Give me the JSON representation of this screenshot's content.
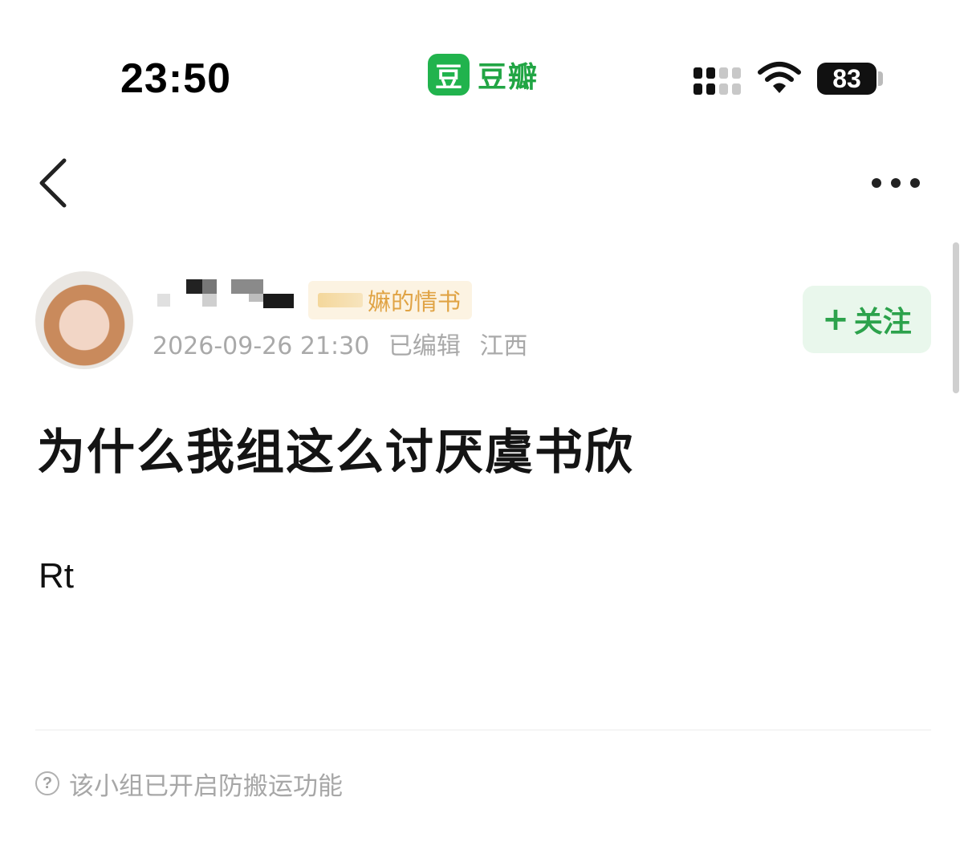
{
  "status_bar": {
    "time": "23:50",
    "app_logo_char": "豆",
    "app_name": "豆瓣",
    "battery": "83",
    "icons": [
      "cellular-signal-icon",
      "wifi-icon",
      "battery-icon"
    ]
  },
  "nav": {
    "back_icon": "chevron-left-icon",
    "more_icon": "more-dots-icon"
  },
  "author": {
    "group_tag": "嫲的情书",
    "date": "2026-09-26 21:30",
    "edited": "已编辑",
    "location": "江西"
  },
  "follow": {
    "plus": "+",
    "label": "关注"
  },
  "post": {
    "title": "为什么我组这么讨厌虞书欣",
    "body": "Rt"
  },
  "footer": {
    "help_icon": "?",
    "notice": "该小组已开启防搬运功能"
  },
  "colors": {
    "brand_green": "#21b34d",
    "follow_text": "#2ca24c",
    "follow_bg": "#e9f7ec",
    "tag_text": "#e0a344",
    "meta_gray": "#a9a9a9"
  }
}
